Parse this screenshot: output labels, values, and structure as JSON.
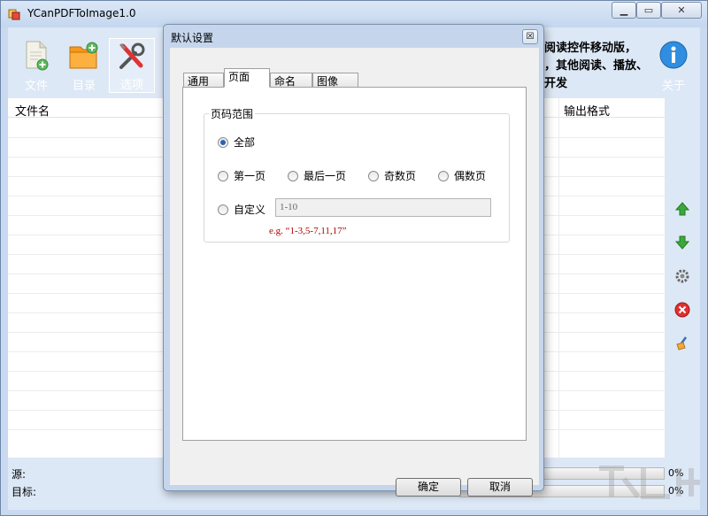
{
  "app": {
    "title": "YCanPDFToImage1.0"
  },
  "toolbar": {
    "file_label": "文件",
    "dir_label": "目录",
    "options_label": "选项",
    "about_label": "关于",
    "right_text": "阅读控件移动版，\n，其他阅读、播放、\n开发"
  },
  "list": {
    "col_filename": "文件名",
    "col_format": "输出格式"
  },
  "status": {
    "source_label": "源:",
    "target_label": "目标:",
    "progress1": "0%",
    "progress2": "0%",
    "progress1_value": 0,
    "progress2_value": 0
  },
  "dialog": {
    "title": "默认设置",
    "tabs": [
      "通用",
      "页面",
      "命名",
      "图像"
    ],
    "active_tab": "页面",
    "group_title": "页码范围",
    "radios": {
      "all": "全部",
      "first": "第一页",
      "last": "最后一页",
      "odd": "奇数页",
      "even": "偶数页",
      "custom": "自定义"
    },
    "selected_radio": "all",
    "custom_placeholder": "1-10",
    "example_hint": "e.g. “1-3,5-7,11,17”",
    "ok_label": "确定",
    "cancel_label": "取消"
  },
  "colors": {
    "client_bg": "#dde8f6",
    "dialog_frame": "#c5d6ec",
    "hint_red": "#b00000",
    "radio_dot": "#2a61b3"
  },
  "icons": {
    "file": "new-document-icon",
    "dir": "add-folder-icon",
    "options": "tools-icon",
    "about": "info-icon",
    "up": "arrow-up-icon",
    "down": "arrow-down-icon",
    "settings": "gear-icon",
    "remove": "remove-icon",
    "clear": "broom-icon"
  }
}
